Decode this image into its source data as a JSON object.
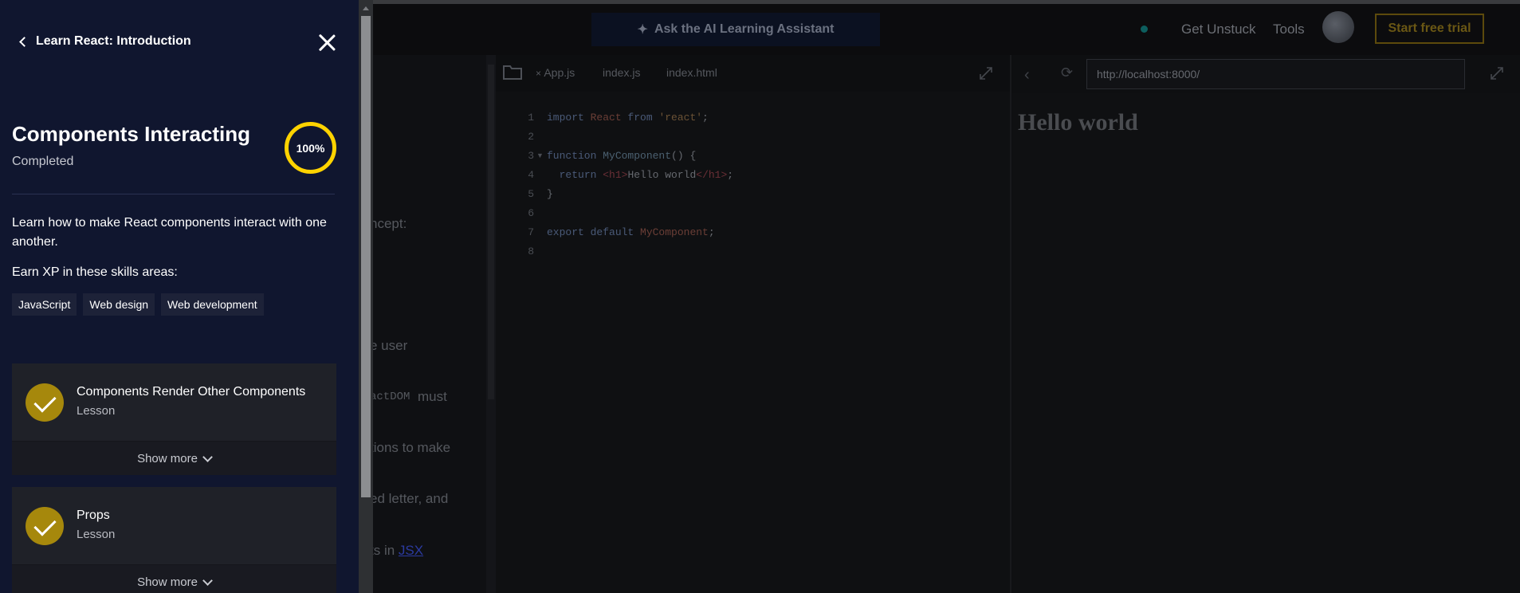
{
  "drawer": {
    "course_title": "Learn React: Introduction",
    "module": {
      "title": "Components Interacting",
      "status": "Completed",
      "progress": "100%",
      "progress_fraction": 1.0,
      "description": "Learn how to make React components interact with one another.",
      "skills_label": "Earn XP in these skills areas:",
      "skills": [
        "JavaScript",
        "Web design",
        "Web development"
      ]
    },
    "items": [
      {
        "title": "Components Render Other Components",
        "type": "Lesson",
        "completed": true,
        "show_more": "Show more"
      },
      {
        "title": "Props",
        "type": "Lesson",
        "completed": true,
        "show_more": "Show more"
      }
    ]
  },
  "header": {
    "ask_ai": "Ask the AI Learning Assistant",
    "get_unstuck": "Get Unstuck",
    "tools": "Tools",
    "trial": "Start free trial"
  },
  "lesson_fragments": [
    "ncept:",
    "e user",
    "actDOM",
    "must",
    "tions to make",
    "ed letter, and",
    "ts in",
    "JSX"
  ],
  "editor": {
    "tabs": [
      "App.js",
      "index.js",
      "index.html"
    ],
    "lines": [
      {
        "num": "1",
        "segments": [
          [
            "kw",
            "import "
          ],
          [
            "ident",
            "React "
          ],
          [
            "kw",
            "from "
          ],
          [
            "str",
            "'react'"
          ],
          [
            "txt",
            ";"
          ]
        ]
      },
      {
        "num": "2",
        "segments": []
      },
      {
        "num": "3",
        "fold": true,
        "segments": [
          [
            "kw",
            "function "
          ],
          [
            "fn",
            "MyComponent"
          ],
          [
            "txt",
            "() {"
          ]
        ]
      },
      {
        "num": "4",
        "segments": [
          [
            "txt",
            "  "
          ],
          [
            "kw",
            "return "
          ],
          [
            "tag",
            "<h1>"
          ],
          [
            "txt",
            "Hello world"
          ],
          [
            "tag",
            "</h1>"
          ],
          [
            "txt",
            ";"
          ]
        ]
      },
      {
        "num": "5",
        "segments": [
          [
            "txt",
            "}"
          ]
        ]
      },
      {
        "num": "6",
        "segments": []
      },
      {
        "num": "7",
        "segments": [
          [
            "kw",
            "export default "
          ],
          [
            "ident",
            "MyComponent"
          ],
          [
            "txt",
            ";"
          ]
        ]
      },
      {
        "num": "8",
        "segments": []
      }
    ]
  },
  "preview": {
    "url": "http://localhost:8000/",
    "heading": "Hello world"
  },
  "colors": {
    "drawer_bg": "#10162f",
    "accent_yellow": "#ffd300",
    "check_fill": "#a6880c"
  }
}
